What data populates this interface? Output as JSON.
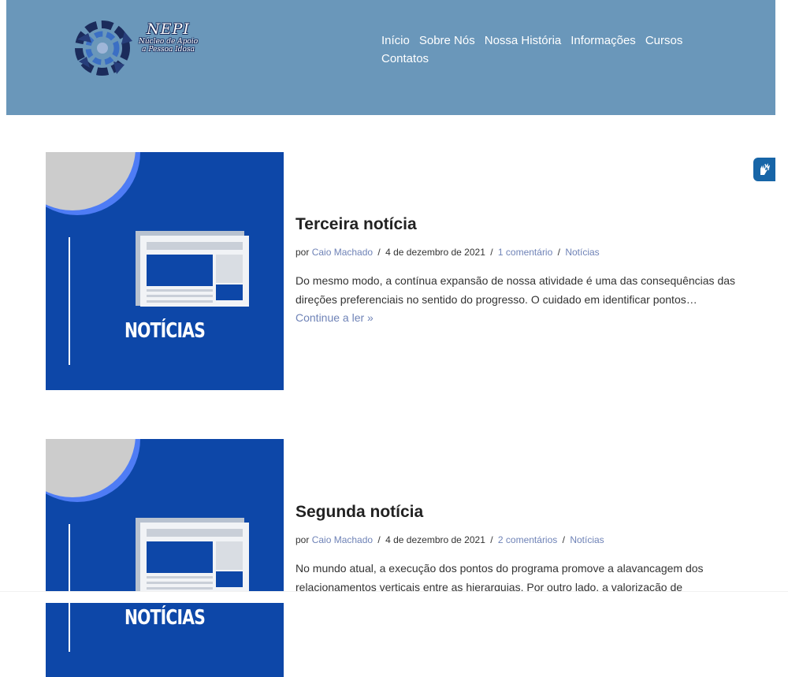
{
  "logo": {
    "title": "NEPI",
    "line1": "Núcleo de Apoio",
    "line2": "a Pessoa Idosa"
  },
  "nav": [
    {
      "label": "Início"
    },
    {
      "label": "Sobre Nós"
    },
    {
      "label": "Nossa História"
    },
    {
      "label": "Informações"
    },
    {
      "label": "Cursos"
    },
    {
      "label": "Contatos"
    }
  ],
  "accessibility": {
    "icon": "sign-language-hands-icon"
  },
  "posts": [
    {
      "title": "Terceira notícia",
      "thumbnail_label": "NOTÍCIAS",
      "meta_by": "por",
      "author": "Caio Machado",
      "sep1": "/",
      "date": "4 de dezembro de 2021",
      "sep2": "/",
      "comments": "1 comentário",
      "sep3": "/",
      "category": "Notícias",
      "excerpt": "Do mesmo modo, a contínua expansão de nossa atividade é uma das consequências das direções preferenciais no sentido do progresso. O cuidado em identificar pontos…",
      "read_more": "Continue a ler »"
    },
    {
      "title": "Segunda notícia",
      "thumbnail_label": "NOTÍCIAS",
      "meta_by": "por",
      "author": "Caio Machado",
      "sep1": "/",
      "date": "4 de dezembro de 2021",
      "sep2": "/",
      "comments": "2 comentários",
      "sep3": "/",
      "category": "Notícias",
      "excerpt": "No mundo atual, a execução dos pontos do programa promove a alavancagem dos relacionamentos verticais entre as hierarquias. Por outro lado, a valorização de"
    }
  ],
  "colors": {
    "header": "#6a97ba",
    "thumb_bg": "#0d47a8",
    "link": "#6f83b7",
    "accent_ring": "#4e7cf5"
  }
}
